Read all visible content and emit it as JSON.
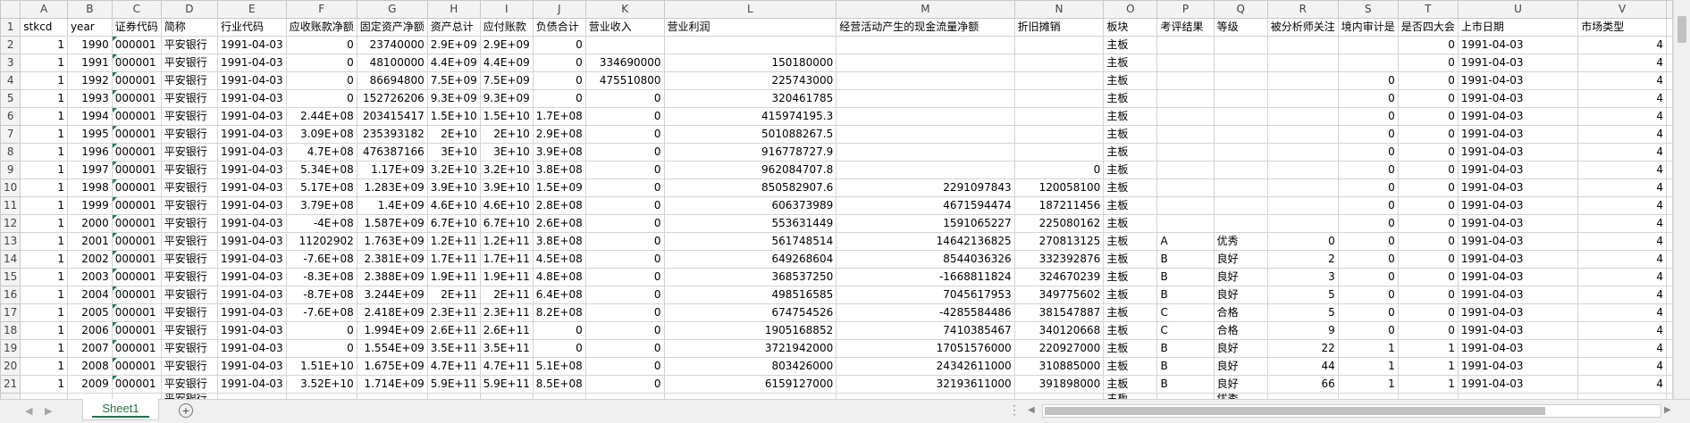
{
  "columns": [
    "A",
    "B",
    "C",
    "D",
    "E",
    "F",
    "G",
    "H",
    "I",
    "J",
    "K",
    "L",
    "M",
    "N",
    "O",
    "P",
    "Q",
    "R",
    "S",
    "T",
    "U",
    "V"
  ],
  "headers": [
    "stkcd",
    "year",
    "证券代码",
    "简称",
    "行业代码",
    "应收账款净额",
    "固定资产净额",
    "资产总计",
    "应付账款",
    "负债合计",
    "营业收入",
    "营业利润",
    "经营活动产生的现金流量净额",
    "折旧摊销",
    "板块",
    "考评结果",
    "等级",
    "被分析师关注",
    "境内审计是",
    "是否四大会",
    "上市日期",
    "市场类型"
  ],
  "rows": [
    [
      "1",
      "1990",
      "000001",
      "平安银行",
      "1991-04-03",
      "0",
      "23740000",
      "2.9E+09",
      "2.9E+09",
      "0",
      "",
      "",
      "",
      "",
      "主板",
      "",
      "",
      "",
      "",
      "0",
      "1991-04-03",
      "4"
    ],
    [
      "1",
      "1991",
      "000001",
      "平安银行",
      "1991-04-03",
      "0",
      "48100000",
      "4.4E+09",
      "4.4E+09",
      "0",
      "334690000",
      "150180000",
      "",
      "",
      "主板",
      "",
      "",
      "",
      "",
      "0",
      "1991-04-03",
      "4"
    ],
    [
      "1",
      "1992",
      "000001",
      "平安银行",
      "1991-04-03",
      "0",
      "86694800",
      "7.5E+09",
      "7.5E+09",
      "0",
      "475510800",
      "225743000",
      "",
      "",
      "主板",
      "",
      "",
      "",
      "0",
      "0",
      "1991-04-03",
      "4"
    ],
    [
      "1",
      "1993",
      "000001",
      "平安银行",
      "1991-04-03",
      "0",
      "152726206",
      "9.3E+09",
      "9.3E+09",
      "0",
      "0",
      "320461785",
      "",
      "",
      "主板",
      "",
      "",
      "",
      "0",
      "0",
      "1991-04-03",
      "4"
    ],
    [
      "1",
      "1994",
      "000001",
      "平安银行",
      "1991-04-03",
      "2.44E+08",
      "203415417",
      "1.5E+10",
      "1.5E+10",
      "1.7E+08",
      "0",
      "415974195.3",
      "",
      "",
      "主板",
      "",
      "",
      "",
      "0",
      "0",
      "1991-04-03",
      "4"
    ],
    [
      "1",
      "1995",
      "000001",
      "平安银行",
      "1991-04-03",
      "3.09E+08",
      "235393182",
      "2E+10",
      "2E+10",
      "2.9E+08",
      "0",
      "501088267.5",
      "",
      "",
      "主板",
      "",
      "",
      "",
      "0",
      "0",
      "1991-04-03",
      "4"
    ],
    [
      "1",
      "1996",
      "000001",
      "平安银行",
      "1991-04-03",
      "4.7E+08",
      "476387166",
      "3E+10",
      "3E+10",
      "3.9E+08",
      "0",
      "916778727.9",
      "",
      "",
      "主板",
      "",
      "",
      "",
      "0",
      "0",
      "1991-04-03",
      "4"
    ],
    [
      "1",
      "1997",
      "000001",
      "平安银行",
      "1991-04-03",
      "5.34E+08",
      "1.17E+09",
      "3.2E+10",
      "3.2E+10",
      "3.8E+08",
      "0",
      "962084707.8",
      "",
      "0",
      "主板",
      "",
      "",
      "",
      "0",
      "0",
      "1991-04-03",
      "4"
    ],
    [
      "1",
      "1998",
      "000001",
      "平安银行",
      "1991-04-03",
      "5.17E+08",
      "1.283E+09",
      "3.9E+10",
      "3.9E+10",
      "1.5E+09",
      "0",
      "850582907.6",
      "2291097843",
      "120058100",
      "主板",
      "",
      "",
      "",
      "0",
      "0",
      "1991-04-03",
      "4"
    ],
    [
      "1",
      "1999",
      "000001",
      "平安银行",
      "1991-04-03",
      "3.79E+08",
      "1.4E+09",
      "4.6E+10",
      "4.6E+10",
      "2.8E+08",
      "0",
      "606373989",
      "4671594474",
      "187211456",
      "主板",
      "",
      "",
      "",
      "0",
      "0",
      "1991-04-03",
      "4"
    ],
    [
      "1",
      "2000",
      "000001",
      "平安银行",
      "1991-04-03",
      "-4E+08",
      "1.587E+09",
      "6.7E+10",
      "6.7E+10",
      "2.6E+08",
      "0",
      "553631449",
      "1591065227",
      "225080162",
      "主板",
      "",
      "",
      "",
      "0",
      "0",
      "1991-04-03",
      "4"
    ],
    [
      "1",
      "2001",
      "000001",
      "平安银行",
      "1991-04-03",
      "11202902",
      "1.763E+09",
      "1.2E+11",
      "1.2E+11",
      "3.8E+08",
      "0",
      "561748514",
      "14642136825",
      "270813125",
      "主板",
      "A",
      "优秀",
      "0",
      "0",
      "0",
      "1991-04-03",
      "4"
    ],
    [
      "1",
      "2002",
      "000001",
      "平安银行",
      "1991-04-03",
      "-7.6E+08",
      "2.381E+09",
      "1.7E+11",
      "1.7E+11",
      "4.5E+08",
      "0",
      "649268604",
      "8544036326",
      "332392876",
      "主板",
      "B",
      "良好",
      "2",
      "0",
      "0",
      "1991-04-03",
      "4"
    ],
    [
      "1",
      "2003",
      "000001",
      "平安银行",
      "1991-04-03",
      "-8.3E+08",
      "2.388E+09",
      "1.9E+11",
      "1.9E+11",
      "4.8E+08",
      "0",
      "368537250",
      "-1668811824",
      "324670239",
      "主板",
      "B",
      "良好",
      "3",
      "0",
      "0",
      "1991-04-03",
      "4"
    ],
    [
      "1",
      "2004",
      "000001",
      "平安银行",
      "1991-04-03",
      "-8.7E+08",
      "3.244E+09",
      "2E+11",
      "2E+11",
      "6.4E+08",
      "0",
      "498516585",
      "7045617953",
      "349775602",
      "主板",
      "B",
      "良好",
      "5",
      "0",
      "0",
      "1991-04-03",
      "4"
    ],
    [
      "1",
      "2005",
      "000001",
      "平安银行",
      "1991-04-03",
      "-7.6E+08",
      "2.418E+09",
      "2.3E+11",
      "2.3E+11",
      "8.2E+08",
      "0",
      "674754526",
      "-4285584486",
      "381547887",
      "主板",
      "C",
      "合格",
      "5",
      "0",
      "0",
      "1991-04-03",
      "4"
    ],
    [
      "1",
      "2006",
      "000001",
      "平安银行",
      "1991-04-03",
      "0",
      "1.994E+09",
      "2.6E+11",
      "2.6E+11",
      "0",
      "0",
      "1905168852",
      "7410385467",
      "340120668",
      "主板",
      "C",
      "合格",
      "9",
      "0",
      "0",
      "1991-04-03",
      "4"
    ],
    [
      "1",
      "2007",
      "000001",
      "平安银行",
      "1991-04-03",
      "0",
      "1.554E+09",
      "3.5E+11",
      "3.5E+11",
      "0",
      "0",
      "3721942000",
      "17051576000",
      "220927000",
      "主板",
      "B",
      "良好",
      "22",
      "1",
      "1",
      "1991-04-03",
      "4"
    ],
    [
      "1",
      "2008",
      "000001",
      "平安银行",
      "1991-04-03",
      "1.51E+10",
      "1.675E+09",
      "4.7E+11",
      "4.7E+11",
      "5.1E+08",
      "0",
      "803426000",
      "24342611000",
      "310885000",
      "主板",
      "B",
      "良好",
      "44",
      "1",
      "1",
      "1991-04-03",
      "4"
    ],
    [
      "1",
      "2009",
      "000001",
      "平安银行",
      "1991-04-03",
      "3.52E+10",
      "1.714E+09",
      "5.9E+11",
      "5.9E+11",
      "8.5E+08",
      "0",
      "6159127000",
      "32193611000",
      "391898000",
      "主板",
      "B",
      "良好",
      "66",
      "1",
      "1",
      "1991-04-03",
      "4"
    ]
  ],
  "partial_row": [
    "",
    "",
    "",
    "平安银行",
    "",
    "",
    "",
    "",
    "",
    "",
    "",
    "",
    "",
    "",
    "主板",
    "",
    "优秀",
    "",
    "",
    "",
    "",
    ""
  ],
  "sheet_tab": "Sheet1",
  "add_sheet": "+",
  "overflow_dots": "⋮",
  "colors": {
    "grid_line": "#d4d4d4",
    "header_bg": "#f3f3f3",
    "accent": "#217346"
  }
}
